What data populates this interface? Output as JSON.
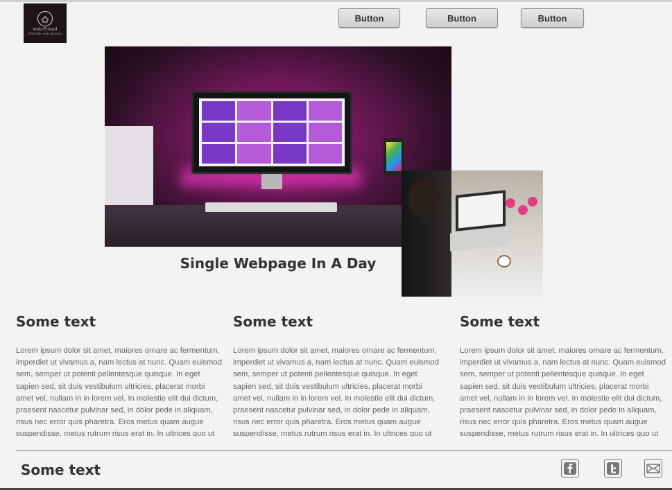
{
  "header": {
    "logo": {
      "tagline": "web-Friend",
      "sub": "affordable web solutions"
    },
    "buttons": [
      "Button",
      "Button",
      "Button"
    ]
  },
  "hero": {
    "title": "Single Webpage In A Day",
    "main_image": "desk-computer-pink-image",
    "secondary_image": "woman-laptop-image"
  },
  "columns": [
    {
      "heading": "Some text",
      "body": "Lorem ipsum dolor sit amet, maiores ornare ac fermentum, imperdiet ut vivamus a, nam lectus at nunc. Quam euismod sem, semper ut potenti pellentesque quisque. In eget sapien sed, sit duis vestibulum ultricies, placerat morbi amet vel, nullam in in lorem vel. In molestie elit dui dictum, praesent nascetur pulvinar sed, in dolor pede in aliquam, risus nec error quis pharetra. Eros metus quam augue suspendisse, metus rutrum risus erat in.  In ultrices quo ut lectus, etiam"
    },
    {
      "heading": "Some text",
      "body": "Lorem ipsum dolor sit amet, maiores ornare ac fermentum, imperdiet ut vivamus a, nam lectus at nunc. Quam euismod sem, semper ut potenti pellentesque quisque. In eget sapien sed, sit duis vestibulum ultricies, placerat morbi amet vel, nullam in in lorem vel. In molestie elit dui dictum, praesent nascetur pulvinar sed, in dolor pede in aliquam, risus nec error quis pharetra. Eros metus quam augue suspendisse, metus rutrum risus erat in.  In ultrices quo ut lectus, etiam"
    },
    {
      "heading": "Some text",
      "body": "Lorem ipsum dolor sit amet, maiores ornare ac fermentum, imperdiet ut vivamus a, nam lectus at nunc. Quam euismod sem, semper ut potenti pellentesque quisque. In eget sapien sed, sit duis vestibulum ultricies, placerat morbi amet vel, nullam in in lorem vel. In molestie elit dui dictum, praesent nascetur pulvinar sed, in dolor pede in aliquam, risus nec error quis pharetra. Eros metus quam augue suspendisse, metus rutrum risus erat in.  In ultrices quo ut lectus, etiam"
    }
  ],
  "footer": {
    "title": "Some text",
    "social_icons": [
      "facebook-icon",
      "twitter-icon",
      "email-icon"
    ]
  },
  "colors": {
    "background": "#f3f3f3",
    "heading": "#333333",
    "body_text": "#666666",
    "accent_pink": "#b3157d"
  }
}
